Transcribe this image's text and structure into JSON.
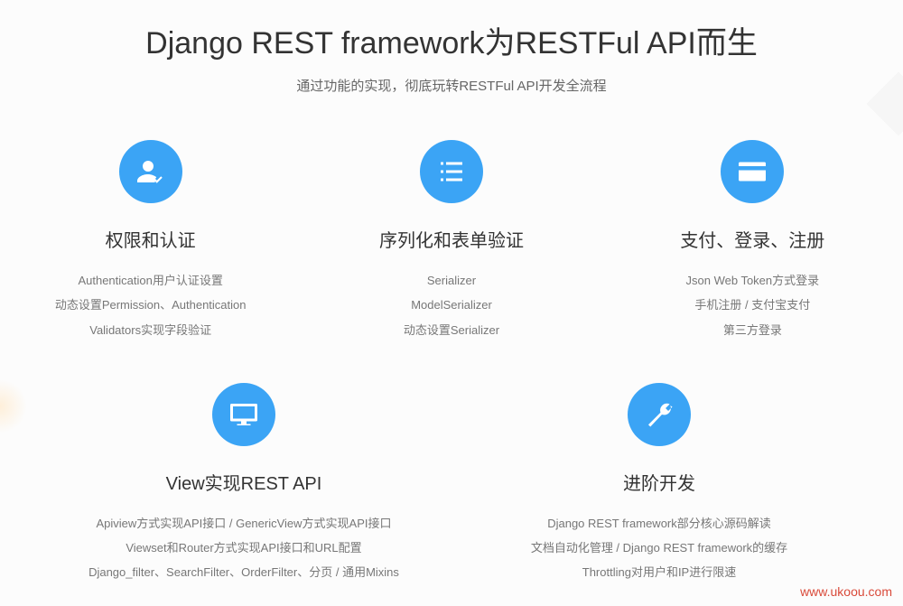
{
  "header": {
    "title": "Django REST framework为RESTFul API而生",
    "subtitle": "通过功能的实现，彻底玩转RESTFul API开发全流程"
  },
  "features": {
    "auth": {
      "title": "权限和认证",
      "items": [
        "Authentication用户认证设置",
        "动态设置Permission、Authentication",
        "Validators实现字段验证"
      ]
    },
    "serialize": {
      "title": "序列化和表单验证",
      "items": [
        "Serializer",
        "ModelSerializer",
        "动态设置Serializer"
      ]
    },
    "pay": {
      "title": "支付、登录、注册",
      "items": [
        "Json Web Token方式登录",
        "手机注册 / 支付宝支付",
        "第三方登录"
      ]
    },
    "view": {
      "title": "View实现REST API",
      "items": [
        "Apiview方式实现API接口 / GenericView方式实现API接口",
        "Viewset和Router方式实现API接口和URL配置",
        "Django_filter、SearchFilter、OrderFilter、分页 / 通用Mixins"
      ]
    },
    "advanced": {
      "title": "进阶开发",
      "items": [
        "Django REST framework部分核心源码解读",
        "文档自动化管理 / Django REST framework的缓存",
        "Throttling对用户和IP进行限速"
      ]
    }
  },
  "watermark": "www.ukoou.com"
}
